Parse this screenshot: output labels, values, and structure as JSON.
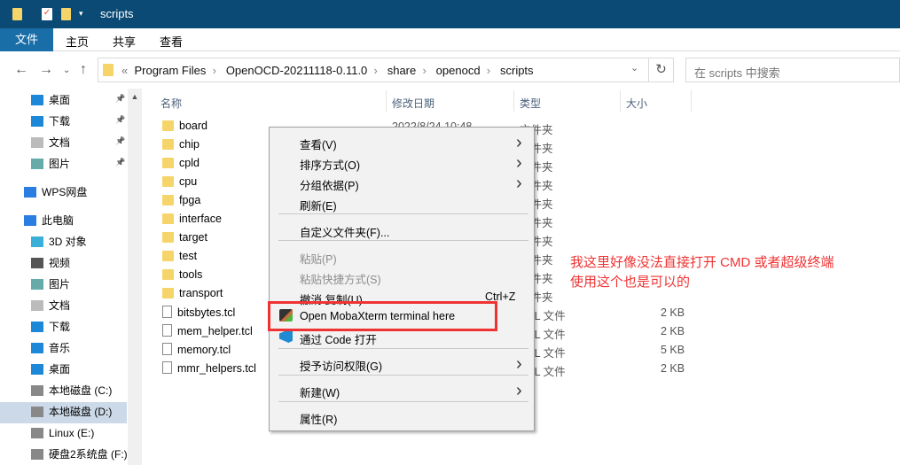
{
  "window": {
    "title": "scripts"
  },
  "ribbon": {
    "tabs": [
      "文件",
      "主页",
      "共享",
      "查看"
    ]
  },
  "address": {
    "prefix": "«",
    "crumbs": [
      "Program Files",
      "OpenOCD-20211118-0.11.0",
      "share",
      "openocd",
      "scripts"
    ],
    "separator": "›"
  },
  "search": {
    "placeholder": "在 scripts 中搜索"
  },
  "sidebar": {
    "items": [
      {
        "label": "桌面",
        "icon": "desktop-icon",
        "pinned": true
      },
      {
        "label": "下载",
        "icon": "download-icon",
        "pinned": true
      },
      {
        "label": "文档",
        "icon": "document-icon",
        "pinned": true
      },
      {
        "label": "图片",
        "icon": "picture-icon",
        "pinned": true
      },
      {
        "label": "WPS网盘",
        "icon": "cloud-icon"
      },
      {
        "label": "此电脑",
        "icon": "computer-icon"
      },
      {
        "label": "3D 对象",
        "icon": "3d-icon"
      },
      {
        "label": "视频",
        "icon": "video-icon"
      },
      {
        "label": "图片",
        "icon": "picture-icon"
      },
      {
        "label": "文档",
        "icon": "document-icon"
      },
      {
        "label": "下载",
        "icon": "download-icon"
      },
      {
        "label": "音乐",
        "icon": "music-icon"
      },
      {
        "label": "桌面",
        "icon": "desktop-icon"
      },
      {
        "label": "本地磁盘 (C:)",
        "icon": "drive-icon"
      },
      {
        "label": "本地磁盘 (D:)",
        "icon": "drive-icon",
        "selected": true
      },
      {
        "label": "Linux (E:)",
        "icon": "drive-icon"
      },
      {
        "label": "硬盘2系统盘 (F:)",
        "icon": "drive-icon"
      }
    ]
  },
  "columns": [
    "名称",
    "修改日期",
    "类型",
    "大小"
  ],
  "files": [
    {
      "name": "board",
      "type": "文件夹",
      "kind": "folder",
      "date": "2022/8/24 10:48"
    },
    {
      "name": "chip",
      "type": "文件夹",
      "kind": "folder"
    },
    {
      "name": "cpld",
      "type": "文件夹",
      "kind": "folder"
    },
    {
      "name": "cpu",
      "type": "文件夹",
      "kind": "folder"
    },
    {
      "name": "fpga",
      "type": "文件夹",
      "kind": "folder"
    },
    {
      "name": "interface",
      "type": "文件夹",
      "kind": "folder"
    },
    {
      "name": "target",
      "type": "文件夹",
      "kind": "folder"
    },
    {
      "name": "test",
      "type": "文件夹",
      "kind": "folder"
    },
    {
      "name": "tools",
      "type": "文件夹",
      "kind": "folder"
    },
    {
      "name": "transport",
      "type": "文件夹",
      "kind": "folder"
    },
    {
      "name": "bitsbytes.tcl",
      "type": "TCL 文件",
      "size": "2 KB",
      "kind": "file"
    },
    {
      "name": "mem_helper.tcl",
      "type": "TCL 文件",
      "size": "2 KB",
      "kind": "file"
    },
    {
      "name": "memory.tcl",
      "type": "TCL 文件",
      "size": "5 KB",
      "kind": "file"
    },
    {
      "name": "mmr_helpers.tcl",
      "type": "TCL 文件",
      "size": "2 KB",
      "kind": "file"
    }
  ],
  "context_menu": {
    "items": [
      {
        "label": "查看(V)",
        "submenu": true
      },
      {
        "label": "排序方式(O)",
        "submenu": true
      },
      {
        "label": "分组依据(P)",
        "submenu": true
      },
      {
        "label": "刷新(E)"
      },
      {
        "label": "自定义文件夹(F)..."
      },
      {
        "label": "粘贴(P)",
        "disabled": true
      },
      {
        "label": "粘贴快捷方式(S)",
        "disabled": true
      },
      {
        "label": "撤消 复制(U)",
        "shortcut": "Ctrl+Z"
      },
      {
        "label": "Open MobaXterm terminal here",
        "icon": "mobaxterm-icon",
        "highlighted": true
      },
      {
        "label": "通过 Code 打开",
        "icon": "vscode-icon"
      },
      {
        "label": "授予访问权限(G)",
        "submenu": true
      },
      {
        "label": "新建(W)",
        "submenu": true
      },
      {
        "label": "属性(R)"
      }
    ]
  },
  "annotation": {
    "lines": [
      "我这里好像没法直接打开 CMD 或者超级终端",
      "使用这个也是可以的"
    ],
    "color": "#ef3333"
  }
}
